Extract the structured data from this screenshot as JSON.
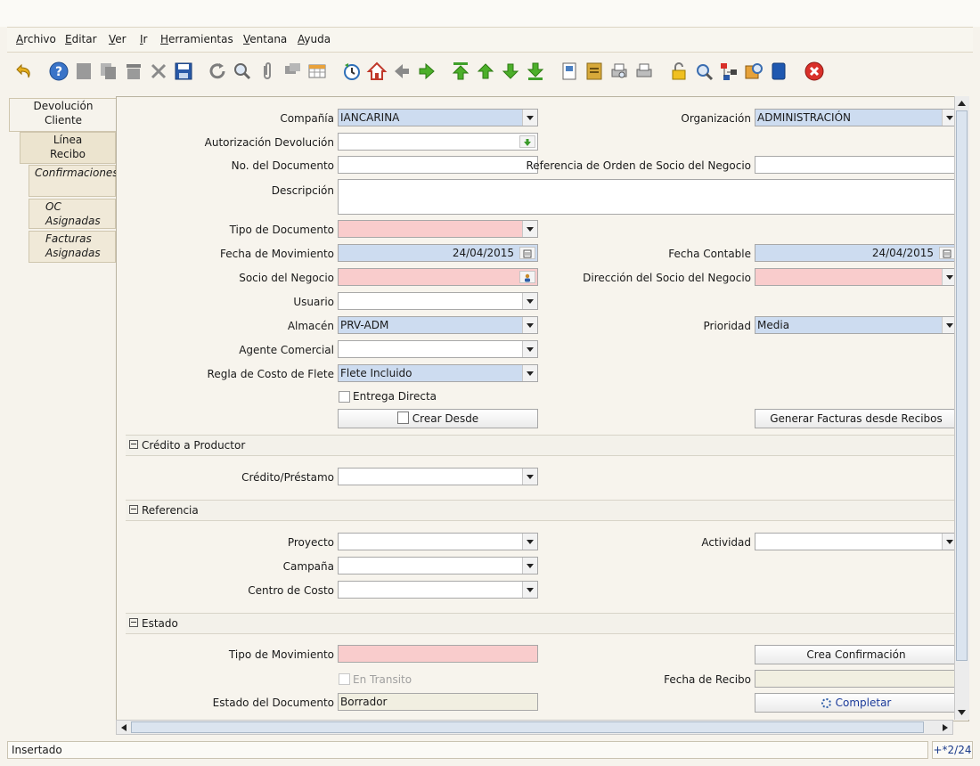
{
  "menu": [
    "Archivo",
    "Editar",
    "Ver",
    "Ir",
    "Herramientas",
    "Ventana",
    "Ayuda"
  ],
  "toolbar_icons": [
    "undo-icon",
    "help-icon",
    "new-icon",
    "copy-icon",
    "delete-icon",
    "delete-selection-icon",
    "save-icon",
    "refresh-icon",
    "find-icon",
    "attachment-icon",
    "chat-icon",
    "grid-toggle-icon",
    "history-icon",
    "home-icon",
    "previous-icon",
    "next-icon",
    "first-record-icon",
    "previous-record-icon",
    "next-record-icon",
    "last-record-icon",
    "report-icon",
    "archive-icon",
    "print-preview-icon",
    "print-icon",
    "lock-icon",
    "zoom-across-icon",
    "workflow-icon",
    "product-info-icon",
    "save-to-disk-icon",
    "exit-icon"
  ],
  "tabs": [
    {
      "label1": "Devolución",
      "label2": "Cliente"
    },
    {
      "label1": "Línea",
      "label2": "Recibo"
    },
    {
      "label1": "Confirmaciones",
      "label2": ""
    },
    {
      "label1": "OC",
      "label2": "Asignadas"
    },
    {
      "label1": "Facturas",
      "label2": "Asignadas"
    }
  ],
  "form": {
    "compania": {
      "label": "Compañía",
      "value": "IANCARINA"
    },
    "organizacion": {
      "label": "Organización",
      "value": "ADMINISTRACIÓN"
    },
    "autorizacion": {
      "label": "Autorización Devolución",
      "value": ""
    },
    "no_documento": {
      "label": "No. del Documento",
      "value": ""
    },
    "referencia_orden": {
      "label": "Referencia de Orden de Socio del Negocio",
      "value": ""
    },
    "descripcion": {
      "label": "Descripción",
      "value": ""
    },
    "tipo_documento": {
      "label": "Tipo de Documento",
      "value": ""
    },
    "fecha_movimiento": {
      "label": "Fecha de Movimiento",
      "value": "24/04/2015"
    },
    "fecha_contable": {
      "label": "Fecha Contable",
      "value": "24/04/2015"
    },
    "socio": {
      "label": "Socio del Negocio",
      "value": ""
    },
    "direccion_socio": {
      "label": "Dirección del Socio del Negocio",
      "value": ""
    },
    "usuario": {
      "label": "Usuario",
      "value": ""
    },
    "almacen": {
      "label": "Almacén",
      "value": "PRV-ADM"
    },
    "prioridad": {
      "label": "Prioridad",
      "value": "Media"
    },
    "agente": {
      "label": "Agente Comercial",
      "value": ""
    },
    "regla_flete": {
      "label": "Regla de Costo de Flete",
      "value": "Flete Incluido"
    },
    "entrega_directa": {
      "label": "Entrega Directa"
    },
    "crear_desde": "Crear Desde",
    "generar_facturas": "Generar Facturas desde Recibos"
  },
  "sections": {
    "credito": {
      "title": "Crédito a Productor",
      "credito_prestamo": {
        "label": "Crédito/Préstamo",
        "value": ""
      }
    },
    "referencia": {
      "title": "Referencia",
      "proyecto": {
        "label": "Proyecto",
        "value": ""
      },
      "actividad": {
        "label": "Actividad",
        "value": ""
      },
      "campana": {
        "label": "Campaña",
        "value": ""
      },
      "centro_costo": {
        "label": "Centro de Costo",
        "value": ""
      }
    },
    "estado": {
      "title": "Estado",
      "tipo_movimiento": {
        "label": "Tipo de Movimiento",
        "value": ""
      },
      "crea_confirmacion": "Crea Confirmación",
      "en_transito": {
        "label": "En Transito"
      },
      "fecha_recibo": {
        "label": "Fecha de Recibo",
        "value": ""
      },
      "estado_documento": {
        "label": "Estado del Documento",
        "value": "Borrador"
      },
      "completar": "Completar"
    }
  },
  "status": {
    "message": "Insertado",
    "record": "+*2/24"
  },
  "colors": {
    "mandatory": "#f9cccc",
    "readonly_blue": "#cddcf0",
    "background": "#f6f3ec"
  }
}
